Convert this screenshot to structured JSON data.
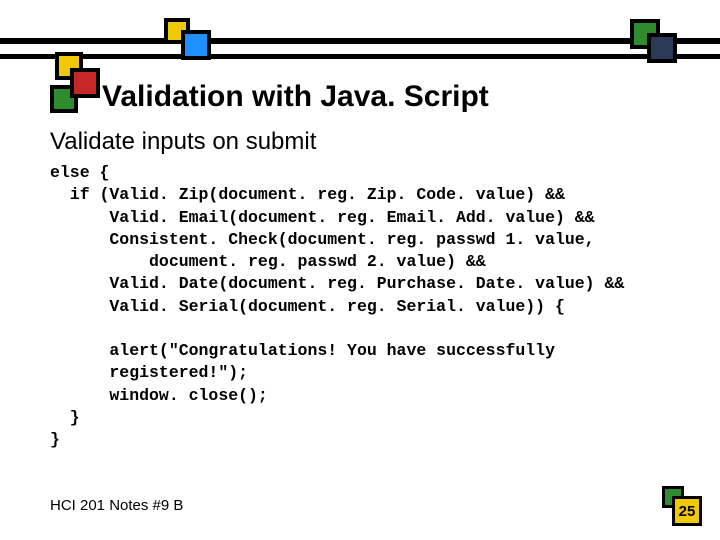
{
  "title": "Validation with Java. Script",
  "subtitle": "Validate inputs on submit",
  "code_lines": [
    "else {",
    "  if (Valid. Zip(document. reg. Zip. Code. value) &&",
    "      Valid. Email(document. reg. Email. Add. value) &&",
    "      Consistent. Check(document. reg. passwd 1. value,",
    "          document. reg. passwd 2. value) &&",
    "      Valid. Date(document. reg. Purchase. Date. value) &&",
    "      Valid. Serial(document. reg. Serial. value)) {",
    "",
    "      alert(\"Congratulations! You have successfully",
    "      registered!\");",
    "      window. close();",
    "  }",
    "}"
  ],
  "footer": "HCI 201 Notes #9 B",
  "page_number": "25"
}
